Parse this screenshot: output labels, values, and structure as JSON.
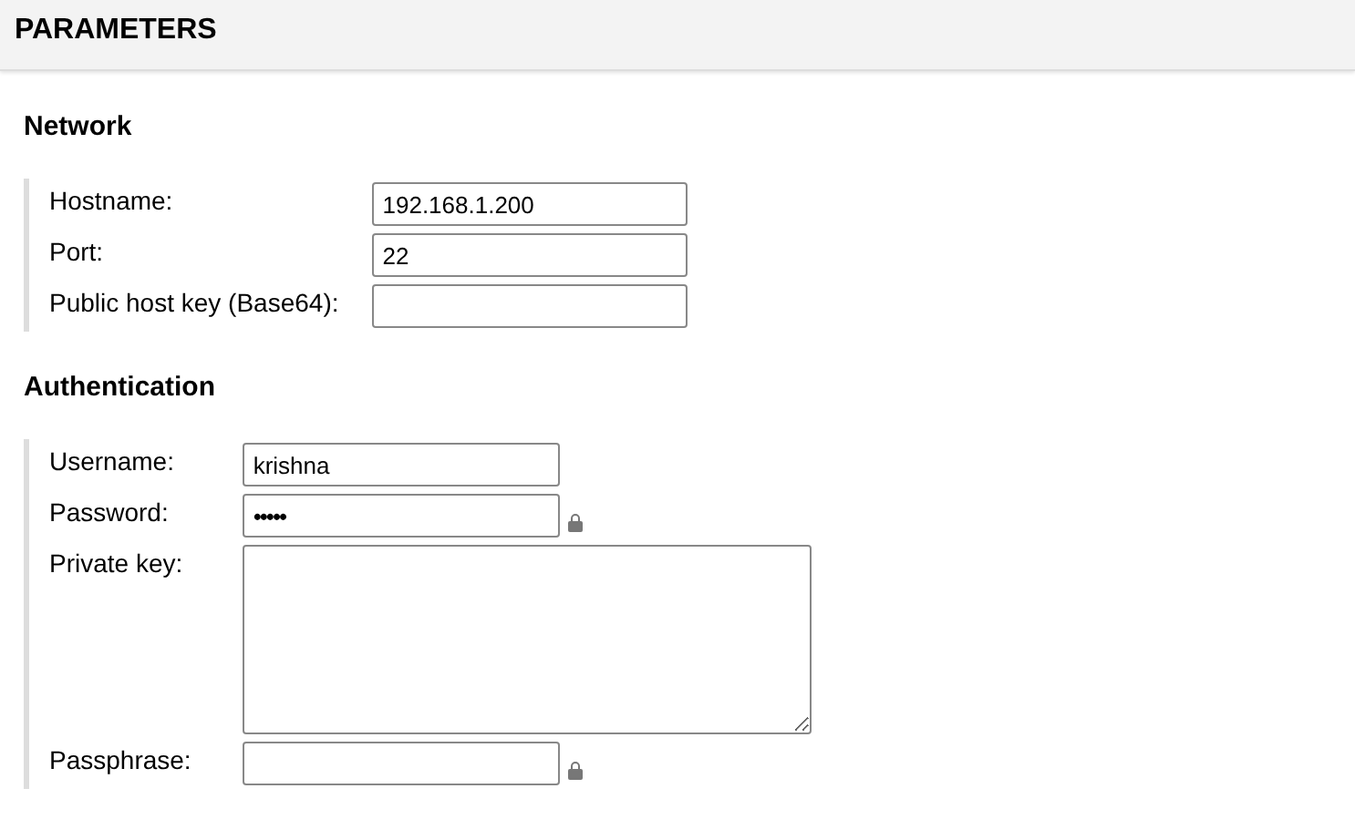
{
  "header": {
    "title": "PARAMETERS"
  },
  "sections": [
    {
      "title": "Network",
      "fields": [
        {
          "label": "Hostname:",
          "kind": "text",
          "value": "192.168.1.200"
        },
        {
          "label": "Port:",
          "kind": "text",
          "value": "22"
        },
        {
          "label": "Public host key (Base64):",
          "kind": "text"
        }
      ]
    },
    {
      "title": "Authentication",
      "fields": [
        {
          "label": "Username:",
          "kind": "text",
          "value": "krishna"
        },
        {
          "label": "Password:",
          "kind": "password",
          "value": "•••••"
        },
        {
          "label": "Private key:",
          "kind": "textarea"
        },
        {
          "label": "Passphrase:",
          "kind": "password"
        }
      ]
    }
  ]
}
